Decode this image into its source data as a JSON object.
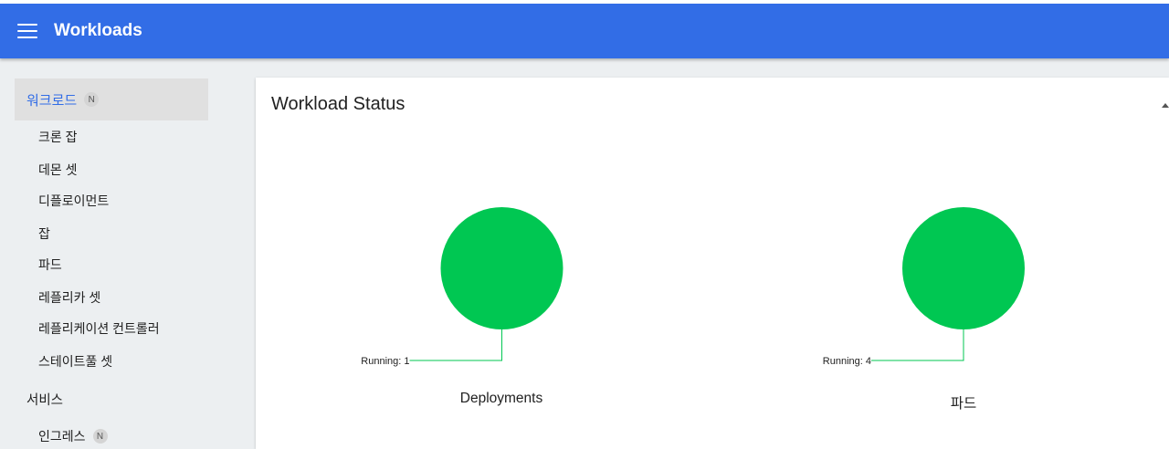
{
  "toolbar": {
    "title": "Workloads",
    "menu_icon": "hamburger-menu-icon",
    "color": "#326de6"
  },
  "sidebar": {
    "header": {
      "label": "워크로드",
      "badge": "N"
    },
    "items": [
      {
        "label": "크론 잡"
      },
      {
        "label": "데몬 셋"
      },
      {
        "label": "디플로이먼트"
      },
      {
        "label": "잡"
      },
      {
        "label": "파드"
      },
      {
        "label": "레플리카 셋"
      },
      {
        "label": "레플리케이션 컨트롤러"
      },
      {
        "label": "스테이트풀 셋"
      }
    ],
    "section": {
      "label": "서비스"
    },
    "section_items": [
      {
        "label": "인그레스",
        "badge": "N"
      }
    ]
  },
  "card": {
    "title": "Workload Status",
    "collapse_icon": "collapse-up-icon"
  },
  "chart_data": [
    {
      "type": "pie",
      "title": "Deployments",
      "slices": [
        {
          "label": "Running",
          "value": 1,
          "display": "Running: 1",
          "color": "#00c752"
        }
      ]
    },
    {
      "type": "pie",
      "title": "파드",
      "slices": [
        {
          "label": "Running",
          "value": 4,
          "display": "Running: 4",
          "color": "#00c752"
        }
      ]
    }
  ]
}
